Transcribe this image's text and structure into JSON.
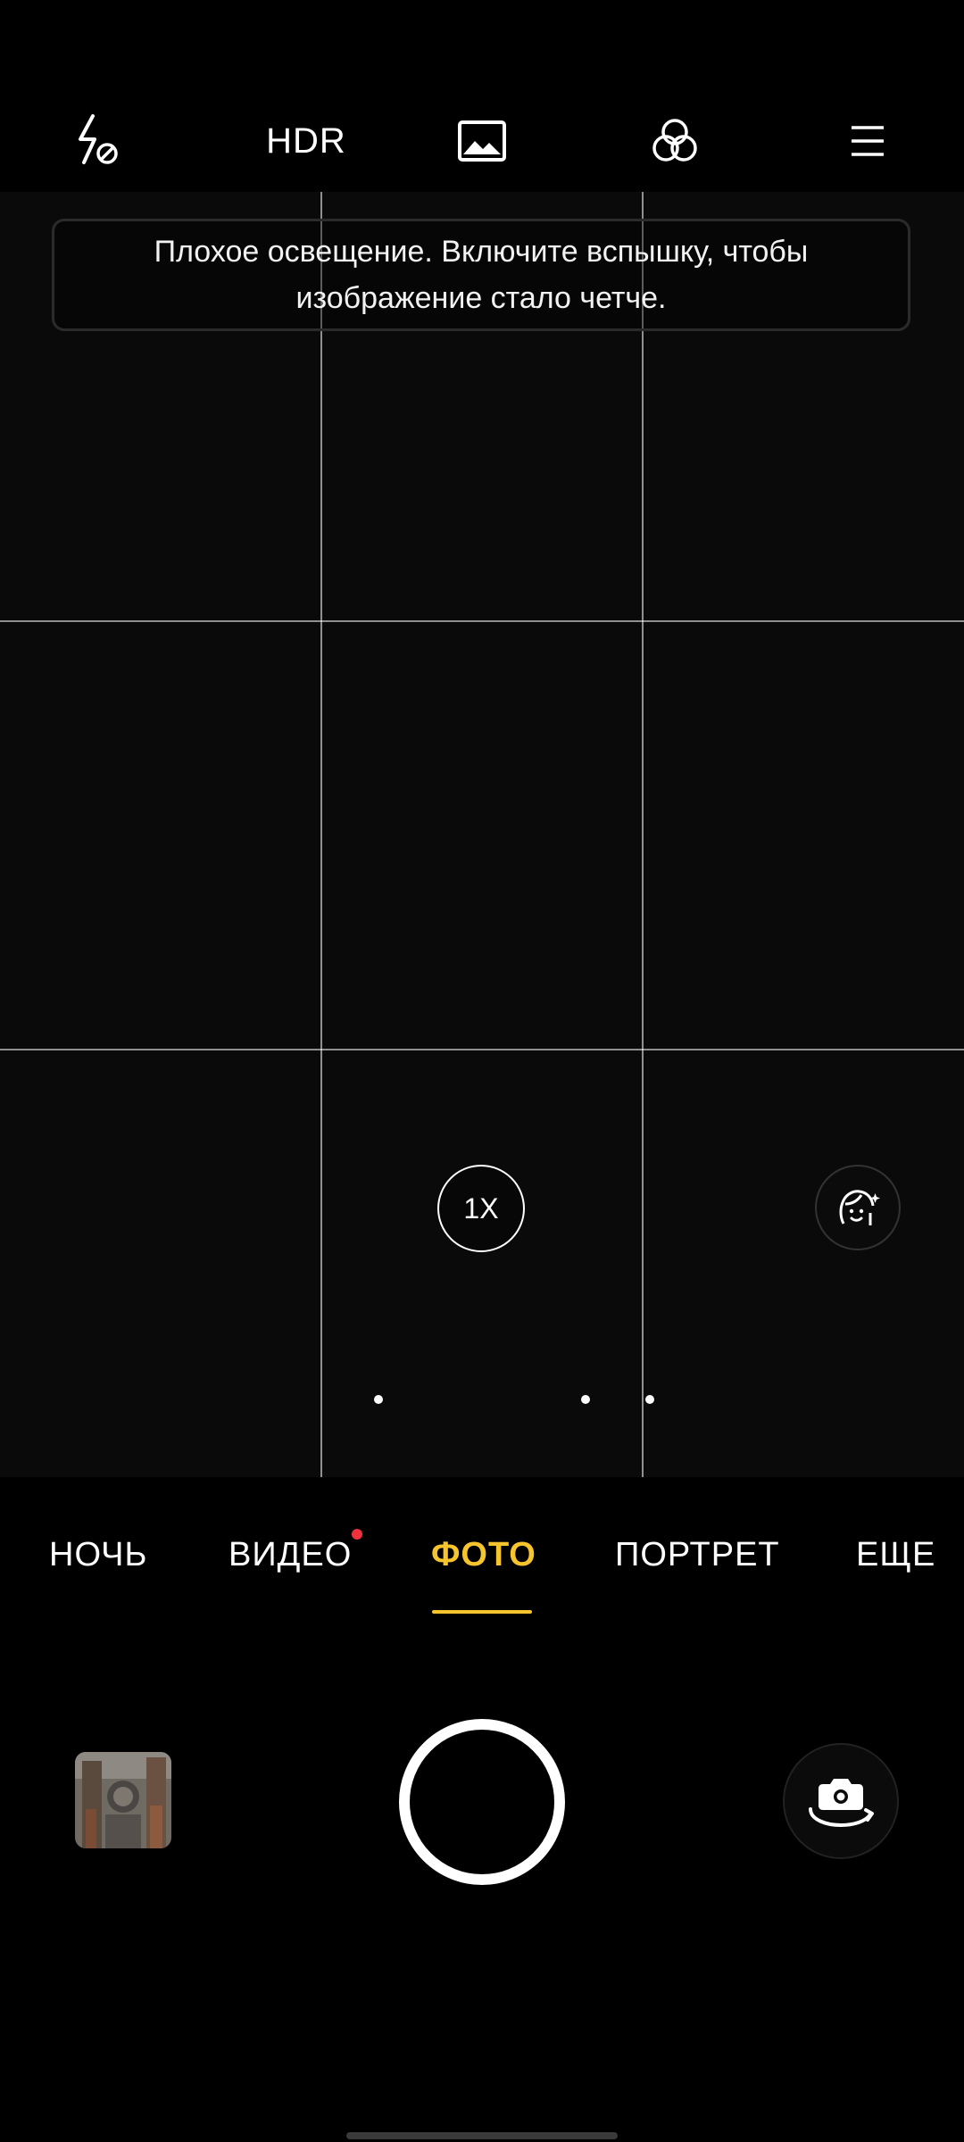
{
  "topbar": {
    "icons": [
      "flash-off-icon",
      "hdr-icon",
      "image-icon",
      "filters-icon",
      "menu-icon"
    ],
    "hdr_label": "HDR"
  },
  "viewfinder": {
    "hint_text": "Плохое освещение. Включите вспышку, чтобы изображение стало четче.",
    "zoom_label": "1X"
  },
  "modes": {
    "items": [
      "НОЧЬ",
      "ВИДЕО",
      "ФОТО",
      "ПОРТРЕТ",
      "ЕЩЕ"
    ],
    "active": "ФОТО",
    "new_indicator_on": "ВИДЕО"
  },
  "colors": {
    "accent": "#f6c42d",
    "badge": "#f0323c",
    "background": "#000000"
  }
}
